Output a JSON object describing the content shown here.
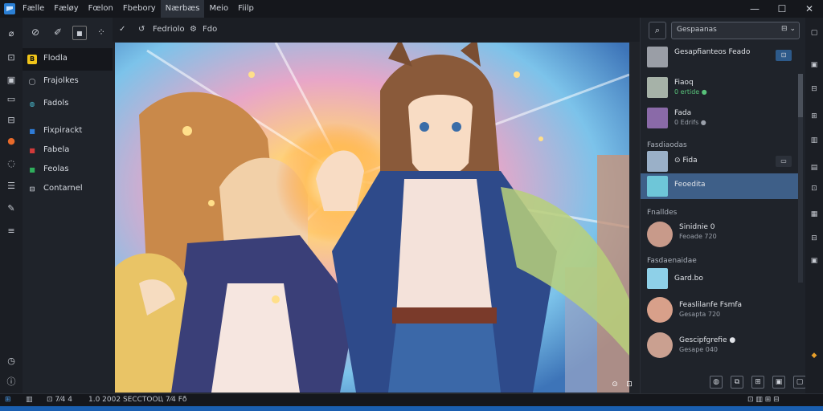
{
  "menubar": {
    "items": [
      {
        "label": "Fælle"
      },
      {
        "label": "Fæløy"
      },
      {
        "label": "Fœlon"
      },
      {
        "label": "Fbebory"
      },
      {
        "label": "Nærbæs"
      },
      {
        "label": "Meio"
      },
      {
        "label": "Fiilp"
      }
    ],
    "active_index": 4,
    "window_controls": [
      "—",
      "☐",
      "✕"
    ]
  },
  "layers_panel": {
    "items": [
      {
        "label": "Flodla",
        "color": "#f0c419",
        "glyph": "B"
      },
      {
        "label": "Frajolkes",
        "color": "#1f232a",
        "glyph": "◯"
      },
      {
        "label": "Fadols",
        "color": "#1f232a",
        "glyph": "◍"
      },
      {
        "label": "Fixpirackt",
        "color": "#2f7bd6",
        "glyph": "■"
      },
      {
        "label": "Fabela",
        "color": "#d23a3a",
        "glyph": "■"
      },
      {
        "label": "Feolas",
        "color": "#2fae5c",
        "glyph": "■"
      },
      {
        "label": "Contarnel",
        "color": "#1f232a",
        "glyph": "⊟"
      }
    ]
  },
  "options_bar": {
    "check": "✓",
    "mode_label": "Fedriolo",
    "value_label": "Fdo"
  },
  "right_panel": {
    "search_value": "Gespaanas",
    "rows": [
      {
        "title": "Gesapfianteos Feado",
        "sub": "",
        "action": "⊡"
      },
      {
        "title": "Fiaoq",
        "sub": "0 ertide ●"
      },
      {
        "title": "Fada",
        "sub": "0 Edrifs ●"
      }
    ],
    "section_1": "Fasdiaodas",
    "rows2": [
      {
        "title": "⊙ Fida",
        "sub": "",
        "action": "▭"
      },
      {
        "title": "Feoedita",
        "sub": ""
      }
    ],
    "section_2": "Fnalldes",
    "rows3": [
      {
        "title": "Sinidnie 0",
        "sub": "Feoade 720"
      }
    ],
    "section_3": "Fasdaenaidae",
    "rows4": [
      {
        "title": "Gard.bo",
        "sub": ""
      },
      {
        "title": "Feaslilanfe Fsmfa",
        "sub": "Gesapta 720"
      },
      {
        "title": "Gescipfgrefie ●",
        "sub": "Gesape 040"
      }
    ]
  },
  "status_bar": {
    "left": "⊞",
    "a": "▥",
    "b": "⊡ 7⁄4 4",
    "c": "1.0 2002 SECCTOOL",
    "d": "\\ 7⁄4 Fð",
    "right": "⊡ ▥ ⊞ ⊟"
  }
}
